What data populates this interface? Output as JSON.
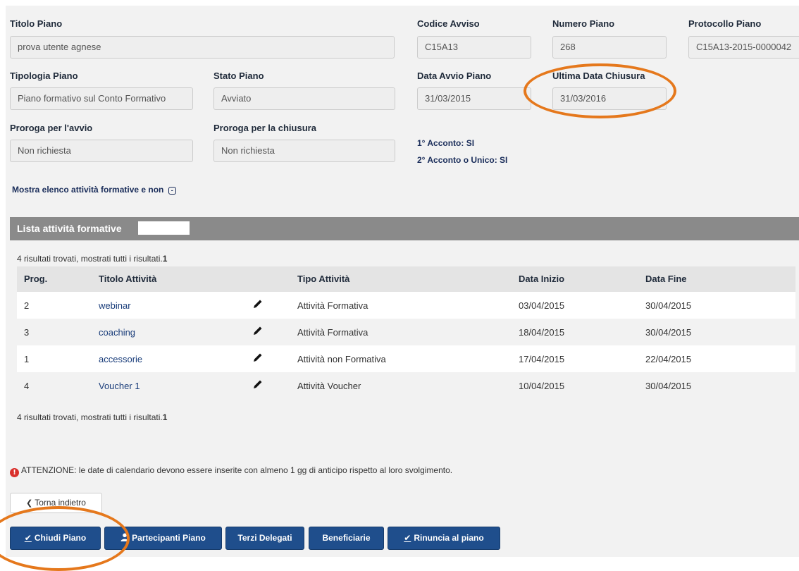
{
  "form": {
    "titolo_piano": {
      "label": "Titolo Piano",
      "value": "prova utente agnese"
    },
    "codice_avviso": {
      "label": "Codice Avviso",
      "value": "C15A13"
    },
    "numero_piano": {
      "label": "Numero Piano",
      "value": "268"
    },
    "protocollo_piano": {
      "label": "Protocollo Piano",
      "value": "C15A13-2015-0000042"
    },
    "tipologia_piano": {
      "label": "Tipologia Piano",
      "value": "Piano formativo sul Conto Formativo"
    },
    "stato_piano": {
      "label": "Stato Piano",
      "value": "Avviato"
    },
    "data_avvio": {
      "label": "Data Avvio Piano",
      "value": "31/03/2015"
    },
    "ultima_data_chiusura": {
      "label": "Ultima Data Chiusura",
      "value": "31/03/2016"
    },
    "proroga_avvio": {
      "label": "Proroga per l'avvio",
      "value": "Non richiesta"
    },
    "proroga_chiusura": {
      "label": "Proroga per la chiusura",
      "value": "Non richiesta"
    },
    "acconto_1": "1° Acconto: SI",
    "acconto_2": "2° Acconto o Unico: SI"
  },
  "toggle_activities": {
    "label": "Mostra elenco attività formative e non",
    "icon": "-"
  },
  "list": {
    "title": "Lista attività formative",
    "results_text": "4 risultati trovati, mostrati tutti i risultati.",
    "results_page": "1",
    "columns": [
      "Prog.",
      "Titolo Attività",
      "Tipo Attività",
      "Data Inizio",
      "Data Fine"
    ],
    "rows": [
      {
        "prog": "2",
        "titolo": "webinar",
        "tipo": "Attività Formativa",
        "inizio": "03/04/2015",
        "fine": "30/04/2015"
      },
      {
        "prog": "3",
        "titolo": "coaching",
        "tipo": "Attività Formativa",
        "inizio": "18/04/2015",
        "fine": "30/04/2015"
      },
      {
        "prog": "1",
        "titolo": "accessorie",
        "tipo": "Attività non Formativa",
        "inizio": "17/04/2015",
        "fine": "22/04/2015"
      },
      {
        "prog": "4",
        "titolo": "Voucher 1",
        "tipo": "Attività Voucher",
        "inizio": "10/04/2015",
        "fine": "30/04/2015"
      }
    ]
  },
  "warning": {
    "icon": "!",
    "text": "ATTENZIONE: le date di calendario devono essere inserite con almeno 1 gg di anticipo rispetto al loro svolgimento."
  },
  "back_button": {
    "icon": "❮",
    "label": "Torna indietro"
  },
  "actions": {
    "chiudi": {
      "icon": "check-underline-icon",
      "glyph": "✔",
      "label": "Chiudi Piano"
    },
    "partecipanti": {
      "icon": "user-icon",
      "label": "Partecipanti Piano"
    },
    "terzi": {
      "label": "Terzi Delegati"
    },
    "beneficiarie": {
      "label": "Beneficiarie"
    },
    "rinuncia": {
      "icon": "check-underline-icon",
      "glyph": "✔",
      "label": "Rinuncia al piano"
    }
  },
  "colors": {
    "primary_button": "#1f4e8c",
    "header_bar": "#8a8a8a",
    "annotation_ring": "#e5781c",
    "warning_icon": "#d9302c"
  }
}
